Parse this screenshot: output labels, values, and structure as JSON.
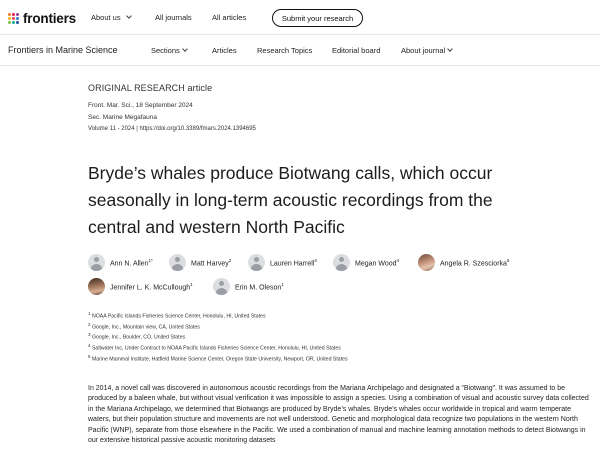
{
  "topbar": {
    "logo_text": "frontiers",
    "nav": [
      {
        "label": "About us",
        "has_menu": true
      },
      {
        "label": "All journals",
        "has_menu": false
      },
      {
        "label": "All articles",
        "has_menu": false
      }
    ],
    "submit_label": "Submit your research"
  },
  "journalbar": {
    "journal_name": "Frontiers in Marine Science",
    "nav": [
      {
        "label": "Sections",
        "has_menu": true
      },
      {
        "label": "Articles",
        "has_menu": false
      },
      {
        "label": "Research Topics",
        "has_menu": false
      },
      {
        "label": "Editorial board",
        "has_menu": false
      },
      {
        "label": "About journal",
        "has_menu": true
      }
    ]
  },
  "article": {
    "type": "ORIGINAL RESEARCH article",
    "citation": "Front. Mar. Sci., 18 September 2024",
    "section": "Sec. Marine Megafauna",
    "volume_doi": "Volume 11 - 2024 | https://doi.org/10.3389/fmars.2024.1394695",
    "title": "Bryde’s whales produce Biotwang calls, which occur seasonally in long-term acoustic recordings from the central and western North Pacific",
    "authors": [
      {
        "name": "Ann N. Allen",
        "sup": "1*",
        "avatar": "placeholder"
      },
      {
        "name": "Matt Harvey",
        "sup": "2",
        "avatar": "placeholder"
      },
      {
        "name": "Lauren Harrell",
        "sup": "3",
        "avatar": "placeholder"
      },
      {
        "name": "Megan Wood",
        "sup": "4",
        "avatar": "placeholder"
      },
      {
        "name": "Angela R. Szesciorka",
        "sup": "5",
        "avatar": "photo"
      },
      {
        "name": "Jennifer L. K. McCullough",
        "sup": "1",
        "avatar": "photo"
      },
      {
        "name": "Erin M. Oleson",
        "sup": "1",
        "avatar": "placeholder"
      }
    ],
    "affiliations": [
      {
        "num": "1",
        "text": "NOAA Pacific Islands Fisheries Science Center, Honolulu, HI, United States"
      },
      {
        "num": "2",
        "text": "Google, Inc., Mountain view, CA, United States"
      },
      {
        "num": "3",
        "text": "Google, Inc., Boulder, CO, United States"
      },
      {
        "num": "4",
        "text": "Saltwater Inc, Under Contract to NOAA Pacific Islands Fisheries Science Center, Honolulu, HI, United States"
      },
      {
        "num": "5",
        "text": "Marine Mammal Institute, Hatfield Marine Science Center, Oregon State University, Newport, OR, United States"
      }
    ],
    "abstract": "In 2014, a novel call was discovered in autonomous acoustic recordings from the Mariana Archipelago and designated a “Biotwang”. It was assumed to be produced by a baleen whale, but without visual verification it was impossible to assign a species. Using a combination of visual and acoustic survey data collected in the Mariana Archipelago, we determined that Biotwangs are produced by Bryde’s whales. Bryde’s whales occur worldwide in tropical and warm temperate waters, but their population structure and movements are not well understood. Genetic and morphological data recognize two populations in the western North Pacific (WNP), separate from those elsewhere in the Pacific. We used a combination of manual and machine learning annotation methods to detect Biotwangs in our extensive historical passive acoustic monitoring datasets"
  }
}
